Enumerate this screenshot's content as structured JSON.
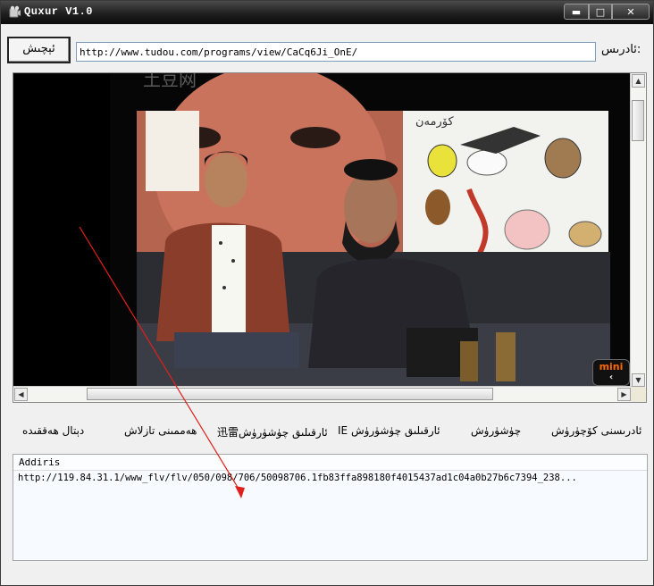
{
  "window": {
    "title": "Quxur V1.0",
    "controls": {
      "minimize": "▬",
      "maximize": "□",
      "close": "✕"
    }
  },
  "address_bar": {
    "go_label": "ئېچىش",
    "url_value": "http://www.tudou.com/programs/view/CaCq6Ji_OnE/",
    "label": "ئادرىس:"
  },
  "video": {
    "watermark": "土豆网",
    "mini_label": "mini",
    "mini_arrow": "‹"
  },
  "toolbar": {
    "copy_address": "ئادرىسنى كۆچۈرۈش",
    "download": "چۈشۈرۈش",
    "ie_download": "IE ئارقىلىق چۈشۈرۈش",
    "xunlei_download": "迅雷ئارقىلىق چۈشۈرۈش",
    "settings": "ھەممىنى تازلاش",
    "detail": "دېتال ھەققىدە"
  },
  "list": {
    "header": "Addiris",
    "rows": [
      "http://119.84.31.1/www_flv/flv/050/098/706/50098706.1fb83ffa898180f4015437ad1c04a0b27b6c7394_238..."
    ]
  },
  "colors": {
    "annotation_arrow": "#e0201a",
    "titlebar": "#1f1f1f",
    "mini_text": "#ff6a00"
  }
}
